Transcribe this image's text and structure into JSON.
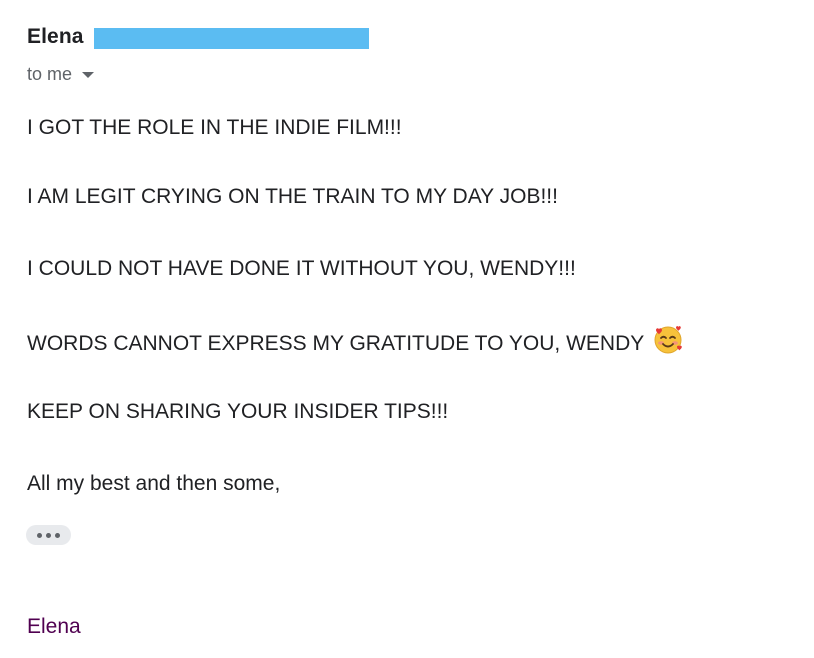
{
  "header": {
    "sender_name": "Elena",
    "recipient_label": "to me",
    "redaction_color": "#5bbcf2",
    "recipient_menu_icon": "chevron-down-icon"
  },
  "message": {
    "lines": [
      "I GOT THE ROLE IN THE INDIE FILM!!!",
      "I AM LEGIT CRYING ON THE TRAIN TO MY DAY JOB!!!",
      "I COULD NOT HAVE DONE IT WITHOUT YOU, WENDY!!!",
      "WORDS CANNOT EXPRESS MY GRATITUDE TO YOU, WENDY",
      "KEEP ON SHARING YOUR INSIDER TIPS!!!",
      "All my best and then some,"
    ],
    "emoji_icon": "smiling-face-with-hearts-icon",
    "show_trimmed_icon": "more-horizontal-icon",
    "signature": "Elena",
    "signature_color": "#500050"
  }
}
